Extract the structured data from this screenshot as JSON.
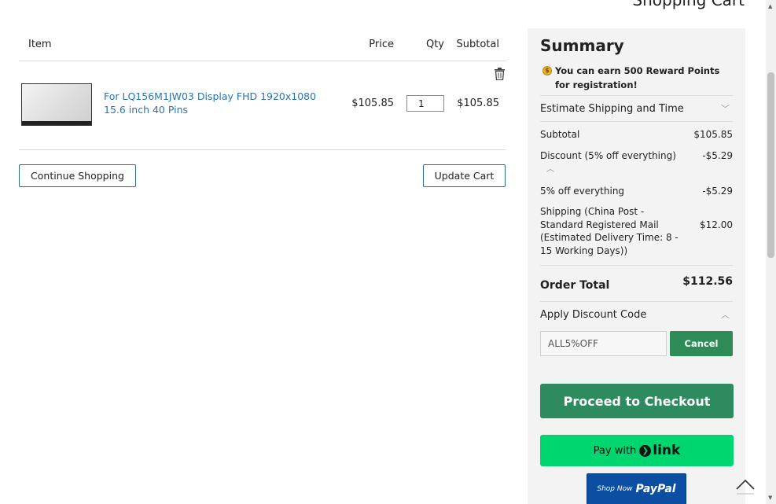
{
  "page": {
    "title": "Shopping Cart"
  },
  "cart": {
    "headers": {
      "item": "Item",
      "price": "Price",
      "qty": "Qty",
      "subtotal": "Subtotal"
    },
    "items": [
      {
        "name": "For LQ156M1JW03 Display FHD 1920x1080 15.6 inch 40 Pins",
        "price": "$105.85",
        "qty": "1",
        "subtotal": "$105.85"
      }
    ],
    "continue_label": "Continue Shopping",
    "update_label": "Update Cart"
  },
  "summary": {
    "title": "Summary",
    "reward_prefix": "You can earn ",
    "reward_points": "500 Reward Points",
    "reward_suffix": " for registration!",
    "shipping_estimate_label": "Estimate Shipping and Time",
    "lines": {
      "subtotal_label": "Subtotal",
      "subtotal_value": "$105.85",
      "discount_label": "Discount (5% off everything)",
      "discount_value": "-$5.29",
      "rule_label": "5% off everything",
      "rule_value": "-$5.29",
      "shipping_label": "Shipping (China Post - Standard Registered Mail (Estimated Delivery Time: 8 - 15 Working Days))",
      "shipping_value": "$12.00"
    },
    "order_total_label": "Order Total",
    "order_total_value": "$112.56",
    "discount_code_label": "Apply Discount Code",
    "discount_code_value": "ALL5%OFF",
    "cancel_label": "Cancel",
    "checkout_label": "Proceed to Checkout",
    "link_pay_prefix": "Pay with",
    "link_brand": "link",
    "paypal_small": "Shop Now",
    "paypal_big": "PayPal"
  },
  "colors": {
    "accent_green": "#2e8b5f",
    "link_green": "#00d66f",
    "paypal_blue": "#0b4ea2",
    "product_link": "#2a74b6"
  },
  "icons": [
    "trash-icon",
    "coin-icon",
    "chevron-down-icon",
    "chevron-up-icon",
    "link-arrow-icon",
    "back-to-top-icon"
  ]
}
